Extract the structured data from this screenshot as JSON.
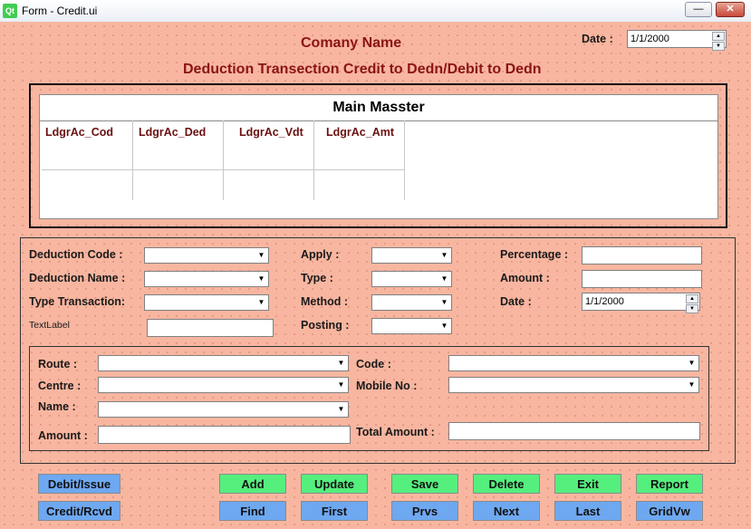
{
  "window": {
    "logo": "Qt",
    "title": "Form - Credit.ui",
    "minimize": "—",
    "close": "✕"
  },
  "header": {
    "company": "Comany Name",
    "subtitle": "Deduction Transection Credit to Dedn/Debit to Dedn",
    "date_label": "Date :",
    "date_value": "1/1/2000"
  },
  "table": {
    "caption": "Main Masster",
    "columns": [
      "LdgrAc_Cod",
      "LdgrAc_Ded",
      "LdgrAc_Vdt",
      "LdgrAc_Amt"
    ]
  },
  "form": {
    "deduction_code": "Deduction Code :",
    "deduction_name": "Deduction Name :",
    "type_transaction": "Type  Transaction:",
    "textlabel": "TextLabel",
    "apply": "Apply :",
    "type": "Type :",
    "method": "Method :",
    "posting": "Posting :",
    "percentage": "Percentage :",
    "amount": "Amount :",
    "date": "Date :",
    "date_value": "1/1/2000"
  },
  "sub": {
    "route": "Route :",
    "centre": "Centre :",
    "name": "Name :",
    "amount": "Amount :",
    "code": "Code :",
    "mobile": "Mobile No :",
    "total": "Total Amount :"
  },
  "buttons": {
    "debit_issue": "Debit/Issue",
    "credit_rcvd": "Credit/Rcvd",
    "add": "Add",
    "update": "Update",
    "save": "Save",
    "delete": "Delete",
    "exit": "Exit",
    "report": "Report",
    "find": "Find",
    "first": "First",
    "prvs": "Prvs",
    "next": "Next",
    "last": "Last",
    "gridvw": "GridVw"
  },
  "icons": {
    "dropdown": "▼",
    "spin_up": "▲",
    "spin_down": "▼"
  }
}
